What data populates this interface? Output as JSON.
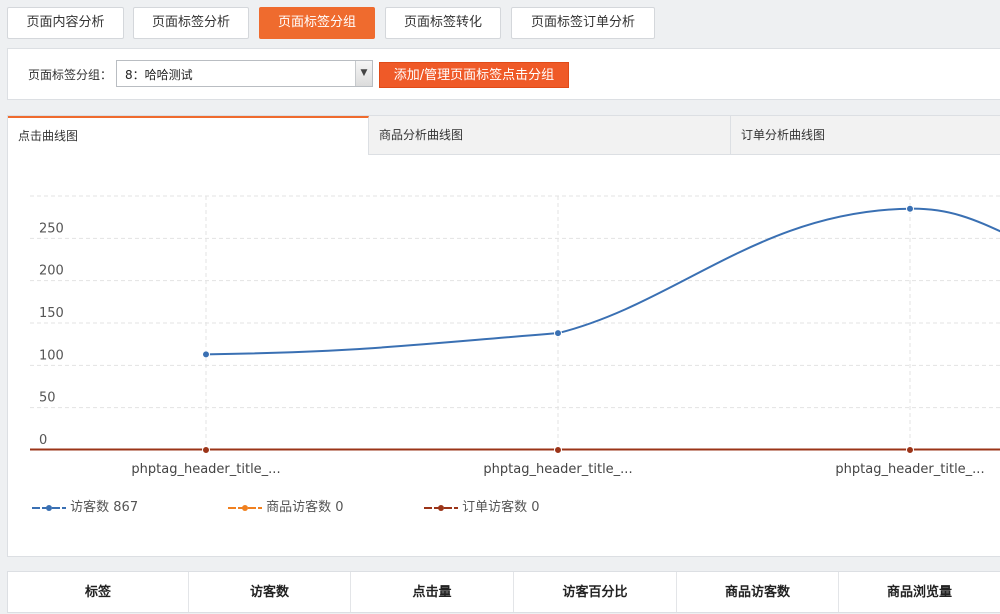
{
  "top_tabs": [
    {
      "label": "页面内容分析",
      "active": false
    },
    {
      "label": "页面标签分析",
      "active": false
    },
    {
      "label": "页面标签分组",
      "active": true
    },
    {
      "label": "页面标签转化",
      "active": false
    },
    {
      "label": "页面标签订单分析",
      "active": false
    }
  ],
  "filter": {
    "label": "页面标签分组：",
    "select_value": "8：哈哈测试",
    "manage_button": "添加/管理页面标签点击分组"
  },
  "chart_tabs": [
    {
      "label": "点击曲线图",
      "active": true
    },
    {
      "label": "商品分析曲线图",
      "active": false
    },
    {
      "label": "订单分析曲线图",
      "active": false
    }
  ],
  "colors": {
    "accent": "#ef6b2e",
    "series_visitors": "#3a70b3",
    "series_product_visitors": "#f0801f",
    "series_order_visitors": "#9b3418"
  },
  "chart_data": {
    "type": "line",
    "categories": [
      "phptag_header_title_...",
      "phptag_header_title_...",
      "phptag_header_title_..."
    ],
    "y_ticks": [
      "250",
      "200",
      "150",
      "100",
      "50",
      "0"
    ],
    "ylim": [
      0,
      300
    ],
    "series": [
      {
        "name": "访客数 867",
        "values": [
          113,
          138,
          285
        ]
      },
      {
        "name": "商品访客数 0",
        "values": [
          0,
          0,
          0
        ]
      },
      {
        "name": "订单访客数 0",
        "values": [
          0,
          0,
          0
        ]
      }
    ],
    "grid": true,
    "legend_position": "bottom-left"
  },
  "table_headers": [
    "标签",
    "访客数",
    "点击量",
    "访客百分比",
    "商品访客数",
    "商品浏览量"
  ]
}
